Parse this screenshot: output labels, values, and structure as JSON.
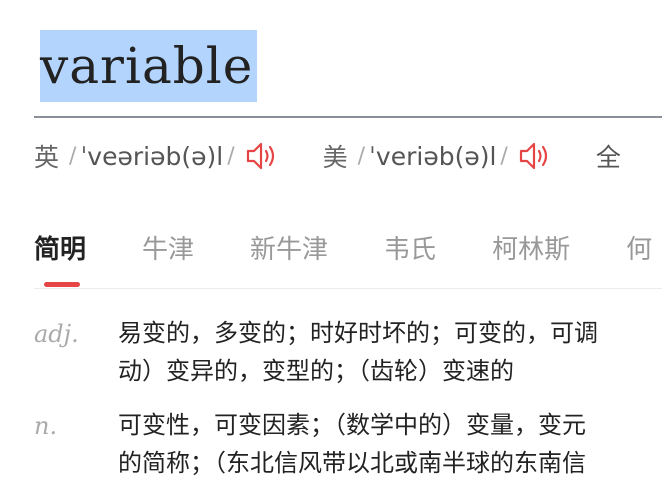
{
  "headword": "variable",
  "pronunciations": [
    {
      "region": "英",
      "ipa": "ˈveəriəb(ə)l"
    },
    {
      "region": "美",
      "ipa": "ˈveriəb(ə)l"
    }
  ],
  "more_label": "全",
  "speaker_icon": "speaker-icon",
  "accent_color": "#e64545",
  "tabs": [
    {
      "label": "简明",
      "active": true
    },
    {
      "label": "牛津"
    },
    {
      "label": "新牛津"
    },
    {
      "label": "韦氏"
    },
    {
      "label": "柯林斯"
    },
    {
      "label": "何"
    }
  ],
  "definitions": [
    {
      "pos": "adj.",
      "lines": [
        "易变的，多变的；时好时坏的；可变的，可调",
        "动）变异的，变型的；（齿轮）变速的"
      ]
    },
    {
      "pos": "n.",
      "lines": [
        "可变性，可变因素；（数学中的）变量，变元",
        "的简称；（东北信风带以北或南半球的东南信"
      ]
    }
  ]
}
